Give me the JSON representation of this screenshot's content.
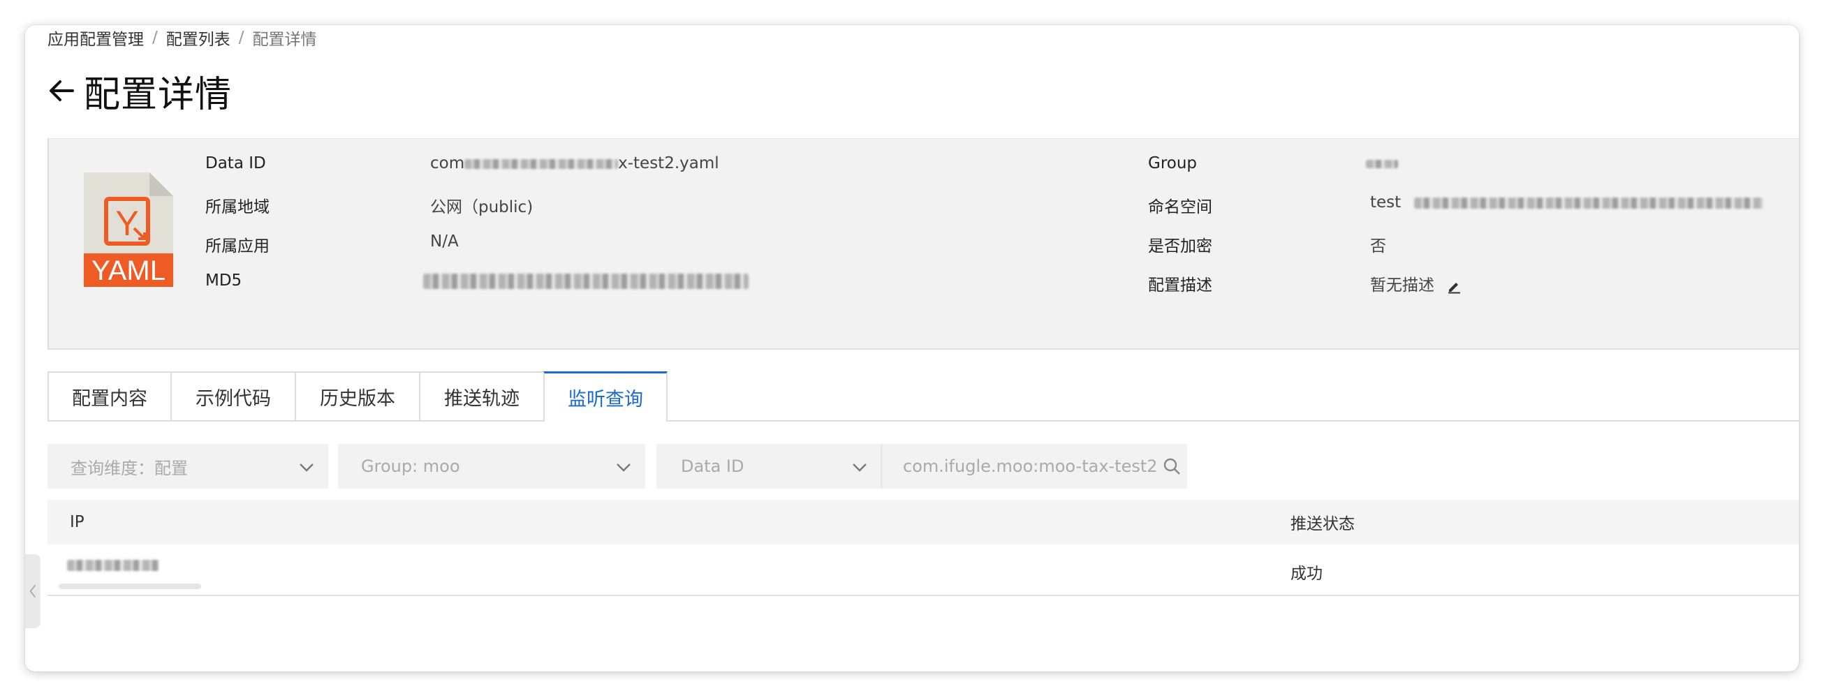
{
  "breadcrumb": {
    "items": [
      "应用配置管理",
      "配置列表",
      "配置详情"
    ],
    "separator": "/"
  },
  "page": {
    "title": "配置详情"
  },
  "file_icon": {
    "label": "YAML",
    "glyph": "Y",
    "color": "#ef5b25"
  },
  "info": {
    "data_id_label": "Data ID",
    "data_id_prefix": "com",
    "data_id_suffix": "x-test2.yaml",
    "region_label": "所属地域",
    "region_value": "公网（public)",
    "app_label": "所属应用",
    "app_value": "N/A",
    "md5_label": "MD5",
    "group_label": "Group",
    "namespace_label": "命名空间",
    "namespace_value": "test",
    "encrypted_label": "是否加密",
    "encrypted_value": "否",
    "desc_label": "配置描述",
    "desc_value": "暂无描述"
  },
  "tabs": [
    {
      "label": "配置内容",
      "active": false
    },
    {
      "label": "示例代码",
      "active": false
    },
    {
      "label": "历史版本",
      "active": false
    },
    {
      "label": "推送轨迹",
      "active": false
    },
    {
      "label": "监听查询",
      "active": true
    }
  ],
  "filters": {
    "dimension": "查询维度：配置",
    "group": "Group: moo",
    "data_id_select": "Data ID",
    "data_id_value": "com.ifugle.moo:moo-tax-test2"
  },
  "table": {
    "headers": [
      "IP",
      "推送状态"
    ],
    "rows": [
      {
        "status": "成功"
      }
    ]
  },
  "colors": {
    "accent": "#1b6ad1",
    "yaml_orange": "#ef5b25",
    "panel_bg": "#f2f2f2"
  }
}
